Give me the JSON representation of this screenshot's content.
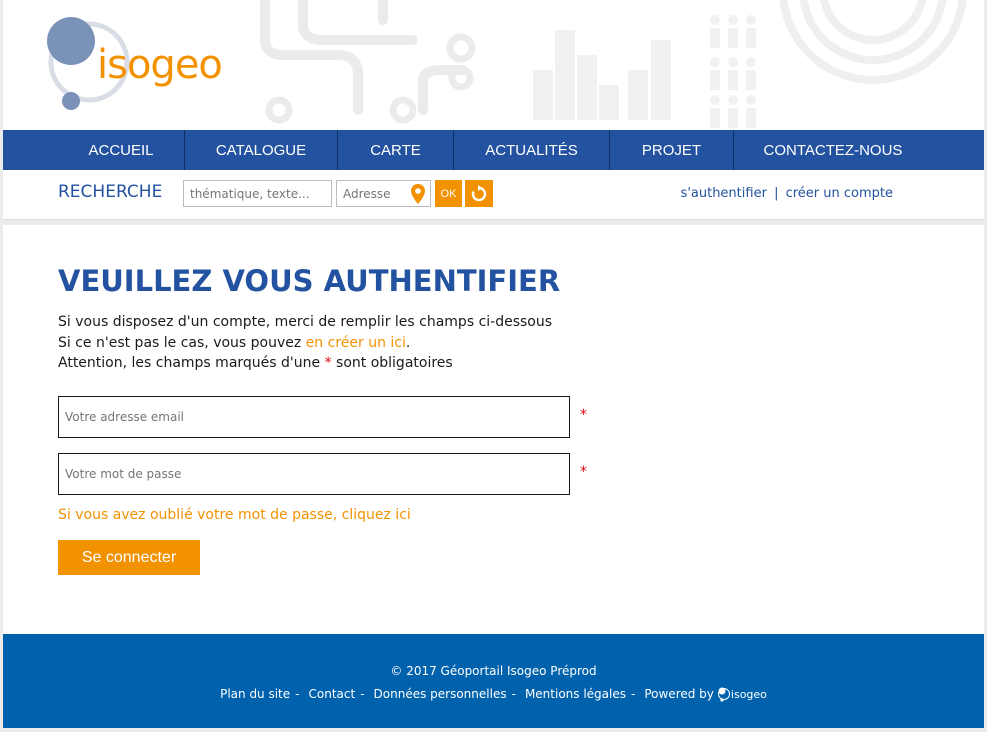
{
  "brand": {
    "name": "isogeo"
  },
  "nav": {
    "items": [
      {
        "label": "ACCUEIL"
      },
      {
        "label": "CATALOGUE"
      },
      {
        "label": "CARTE"
      },
      {
        "label": "ACTUALITÉS"
      },
      {
        "label": "PROJET"
      },
      {
        "label": "CONTACTEZ-NOUS"
      }
    ]
  },
  "search": {
    "title": "RECHERCHE",
    "query_placeholder": "thématique, texte...",
    "address_placeholder": "Adresse",
    "ok_label": "OK",
    "reset_icon": "refresh-icon",
    "pin_icon": "map-pin-icon"
  },
  "auth": {
    "login_label": "s'authentifier",
    "separator": "|",
    "signup_label": "créer un compte"
  },
  "main": {
    "title": "VEUILLEZ VOUS AUTHENTIFIER",
    "intro_line1": "Si vous disposez d'un compte, merci de remplir les champs ci-dessous",
    "intro_line2_prefix": "Si ce n'est pas le cas, vous pouvez ",
    "intro_line2_link": "en créer un ici",
    "intro_line2_suffix": ".",
    "intro_line3_prefix": "Attention, les champs marqués d'une ",
    "intro_line3_star": "*",
    "intro_line3_suffix": " sont obligatoires",
    "email_placeholder": "Votre adresse email",
    "password_placeholder": "Votre mot de passe",
    "required_marker": "*",
    "forgot_label": "Si vous avez oublié votre mot de passe, cliquez ici",
    "submit_label": "Se connecter"
  },
  "footer": {
    "copyright": "© 2017 Géoportail Isogeo Préprod",
    "links": [
      "Plan du site",
      "Contact",
      "Données personnelles",
      "Mentions légales"
    ],
    "separator": "-",
    "powered_label": "Powered by",
    "powered_brand": "isogeo"
  },
  "colors": {
    "primary_blue": "#2353a0",
    "accent_orange": "#f39200",
    "footer_blue": "#0062ad",
    "required_red": "#e3001b"
  }
}
